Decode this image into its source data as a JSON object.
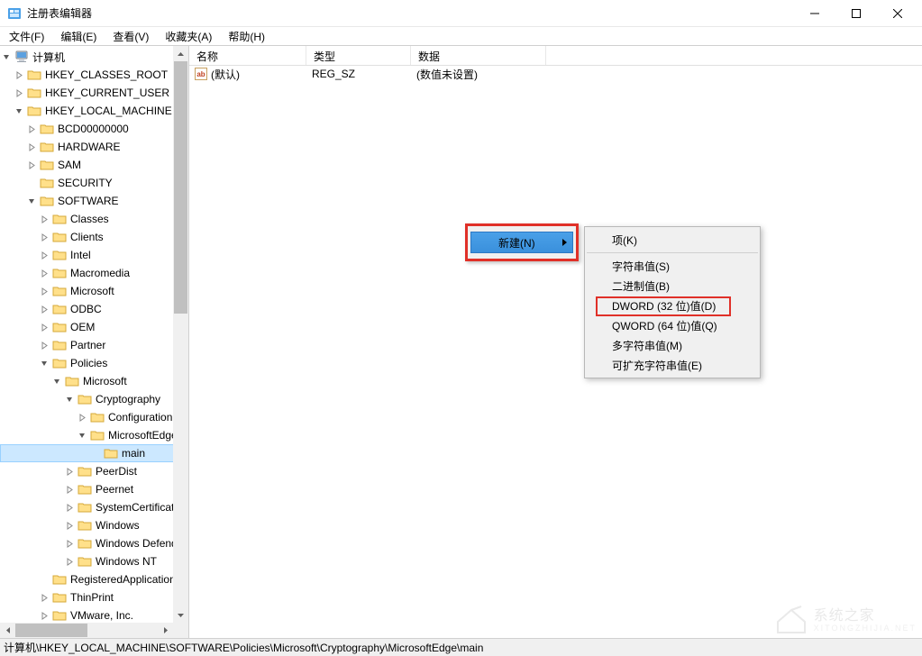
{
  "window": {
    "title": "注册表编辑器"
  },
  "menu": {
    "file": "文件(F)",
    "edit": "编辑(E)",
    "view": "查看(V)",
    "favorites": "收藏夹(A)",
    "help": "帮助(H)"
  },
  "tree": {
    "root": "计算机",
    "hkcr": "HKEY_CLASSES_ROOT",
    "hkcu": "HKEY_CURRENT_USER",
    "hklm": "HKEY_LOCAL_MACHINE",
    "bcd": "BCD00000000",
    "hardware": "HARDWARE",
    "sam": "SAM",
    "security": "SECURITY",
    "software": "SOFTWARE",
    "classes": "Classes",
    "clients": "Clients",
    "intel": "Intel",
    "macromedia": "Macromedia",
    "microsoft": "Microsoft",
    "odbc": "ODBC",
    "oem": "OEM",
    "partner": "Partner",
    "policies": "Policies",
    "p_microsoft": "Microsoft",
    "cryptography": "Cryptography",
    "configuration": "Configuration",
    "microsoftedge": "MicrosoftEdge",
    "main": "main",
    "peerdist": "PeerDist",
    "peernet": "Peernet",
    "systemcert": "SystemCertificates",
    "windows": "Windows",
    "windowsdef": "Windows Defender",
    "windowsnt": "Windows NT",
    "regapps": "RegisteredApplications",
    "thinprint": "ThinPrint",
    "vmware": "VMware, Inc."
  },
  "list": {
    "headers": {
      "name": "名称",
      "type": "类型",
      "data": "数据"
    },
    "rows": [
      {
        "name": "(默认)",
        "type": "REG_SZ",
        "data": "(数值未设置)"
      }
    ]
  },
  "context": {
    "new": "新建(N)",
    "submenu": {
      "key": "项(K)",
      "string": "字符串值(S)",
      "binary": "二进制值(B)",
      "dword": "DWORD (32 位)值(D)",
      "qword": "QWORD (64 位)值(Q)",
      "multi": "多字符串值(M)",
      "expand": "可扩充字符串值(E)"
    }
  },
  "status": {
    "path": "计算机\\HKEY_LOCAL_MACHINE\\SOFTWARE\\Policies\\Microsoft\\Cryptography\\MicrosoftEdge\\main"
  },
  "watermark": {
    "main": "系统之家",
    "sub": "XITONGZHIJIA.NET"
  }
}
